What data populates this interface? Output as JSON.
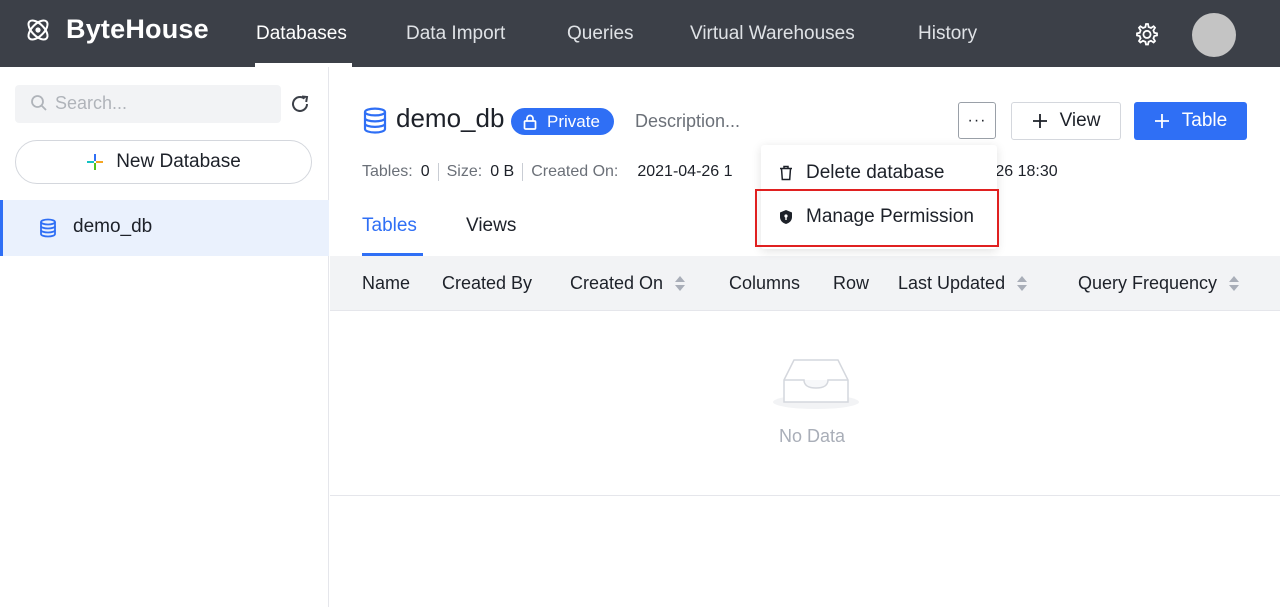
{
  "app": {
    "name": "ByteHouse"
  },
  "nav": {
    "items": [
      {
        "label": "Databases",
        "active": true
      },
      {
        "label": "Data Import"
      },
      {
        "label": "Queries"
      },
      {
        "label": "Virtual Warehouses"
      },
      {
        "label": "History"
      }
    ]
  },
  "sidebar": {
    "search_placeholder": "Search...",
    "new_database_label": "New Database",
    "databases": [
      {
        "label": "demo_db",
        "selected": true
      }
    ]
  },
  "database": {
    "name": "demo_db",
    "visibility": "Private",
    "description_placeholder": "Description...",
    "meta": {
      "tables_label": "Tables:",
      "tables_value": "0",
      "size_label": "Size:",
      "size_value": "0 B",
      "created_label": "Created On:",
      "created_value": "2021-04-26 1",
      "updated_value_partial": "-26 18:30"
    }
  },
  "actions": {
    "more": "···",
    "view_label": "View",
    "table_label": "Table"
  },
  "menu": {
    "items": [
      {
        "label": "Delete database",
        "icon": "trash-icon"
      },
      {
        "label": "Manage Permission",
        "icon": "shield-icon"
      }
    ]
  },
  "tabs": [
    {
      "label": "Tables",
      "active": true
    },
    {
      "label": "Views"
    }
  ],
  "table": {
    "columns": [
      "Name",
      "Created By",
      "Created On",
      "Columns",
      "Row",
      "Last Updated",
      "Query Frequency"
    ],
    "empty_text": "No Data"
  },
  "colors": {
    "brand_blue": "#2f6ff5",
    "topbar": "#3c4048",
    "highlight": "#e02020"
  }
}
